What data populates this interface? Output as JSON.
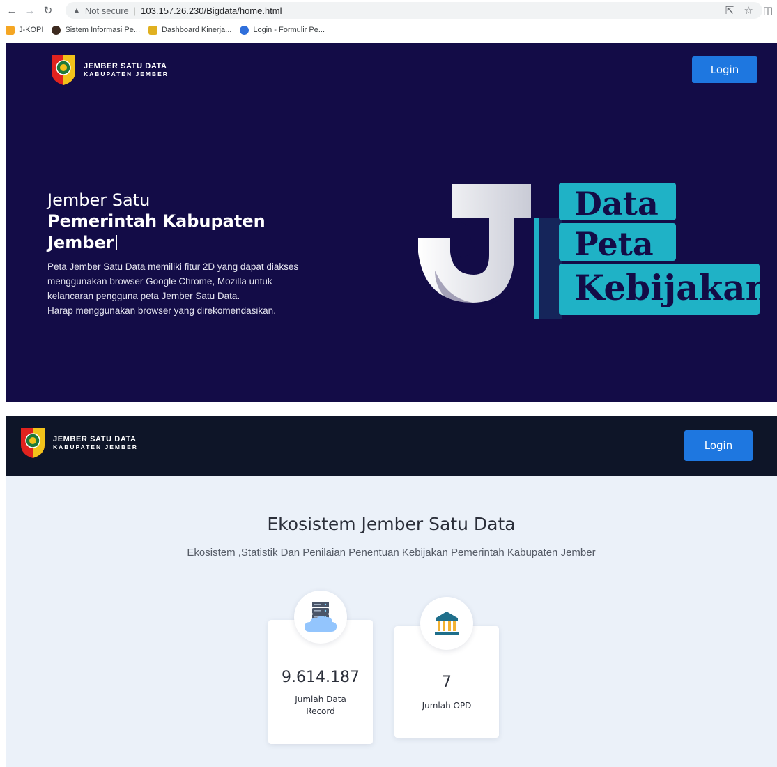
{
  "browser": {
    "security_label": "Not secure",
    "url": "103.157.26.230/Bigdata/home.html",
    "bookmarks": [
      {
        "label": "J-KOPI"
      },
      {
        "label": "Sistem Informasi Pe..."
      },
      {
        "label": "Dashboard Kinerja..."
      },
      {
        "label": "Login - Formulir Pe..."
      }
    ]
  },
  "brand": {
    "name": "JEMBER SATU DATA",
    "subtitle": "KABUPATEN JEMBER"
  },
  "header": {
    "login_label": "Login"
  },
  "hero": {
    "title_line1": "Jember Satu",
    "title_line2": "Pemerintah Kabupaten",
    "title_line3": "Jember",
    "description_lines": [
      "Peta Jember Satu Data memiliki fitur 2D yang dapat diakses",
      "menggunakan browser Google Chrome, Mozilla untuk",
      "kelancaran pengguna peta Jember Satu Data.",
      "Harap menggunakan browser yang direkomendasikan."
    ],
    "logo_words": [
      "Data",
      "Peta",
      "Kebijakan"
    ]
  },
  "ecosystem": {
    "title": "Ekosistem Jember Satu Data",
    "subtitle": "Ekosistem ,Statistik Dan Penilaian Penentuan Kebijakan Pemerintah Kabupaten Jember",
    "stats": [
      {
        "value": "9.614.187",
        "label": "Jumlah Data Record",
        "icon": "server-cloud-icon"
      },
      {
        "value": "7",
        "label": "Jumlah OPD",
        "icon": "government-building-icon"
      }
    ]
  },
  "colors": {
    "hero_bg": "#130c47",
    "header_dark": "#0e1528",
    "accent_blue": "#1e77e0",
    "teal": "#1fb2c6",
    "section_bg": "#ebf1f9"
  }
}
